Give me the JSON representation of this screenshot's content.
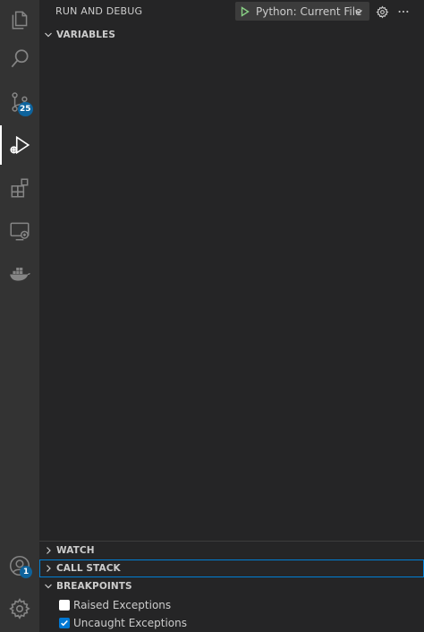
{
  "activity_bar": {
    "items": [
      {
        "name": "explorer",
        "icon": "files-icon"
      },
      {
        "name": "search",
        "icon": "search-icon"
      },
      {
        "name": "source-control",
        "icon": "source-control-icon",
        "badge": "25"
      },
      {
        "name": "run-and-debug",
        "icon": "debug-icon",
        "active": true
      },
      {
        "name": "extensions",
        "icon": "extensions-icon"
      },
      {
        "name": "remote-explorer",
        "icon": "remote-explorer-icon"
      },
      {
        "name": "docker",
        "icon": "docker-icon"
      }
    ],
    "accounts_badge": "1"
  },
  "header": {
    "title": "RUN AND DEBUG",
    "configuration": "Python: Current File"
  },
  "sections": {
    "variables": "VARIABLES",
    "watch": "WATCH",
    "call_stack": "CALL STACK",
    "breakpoints": "BREAKPOINTS"
  },
  "breakpoints": [
    {
      "label": "Raised Exceptions",
      "checked": false
    },
    {
      "label": "Uncaught Exceptions",
      "checked": true
    }
  ],
  "colors": {
    "activity_bar": "#333333",
    "sidebar": "#252526",
    "accent": "#0e639c",
    "focus_border": "#007fd4",
    "play_green": "#89d185"
  }
}
